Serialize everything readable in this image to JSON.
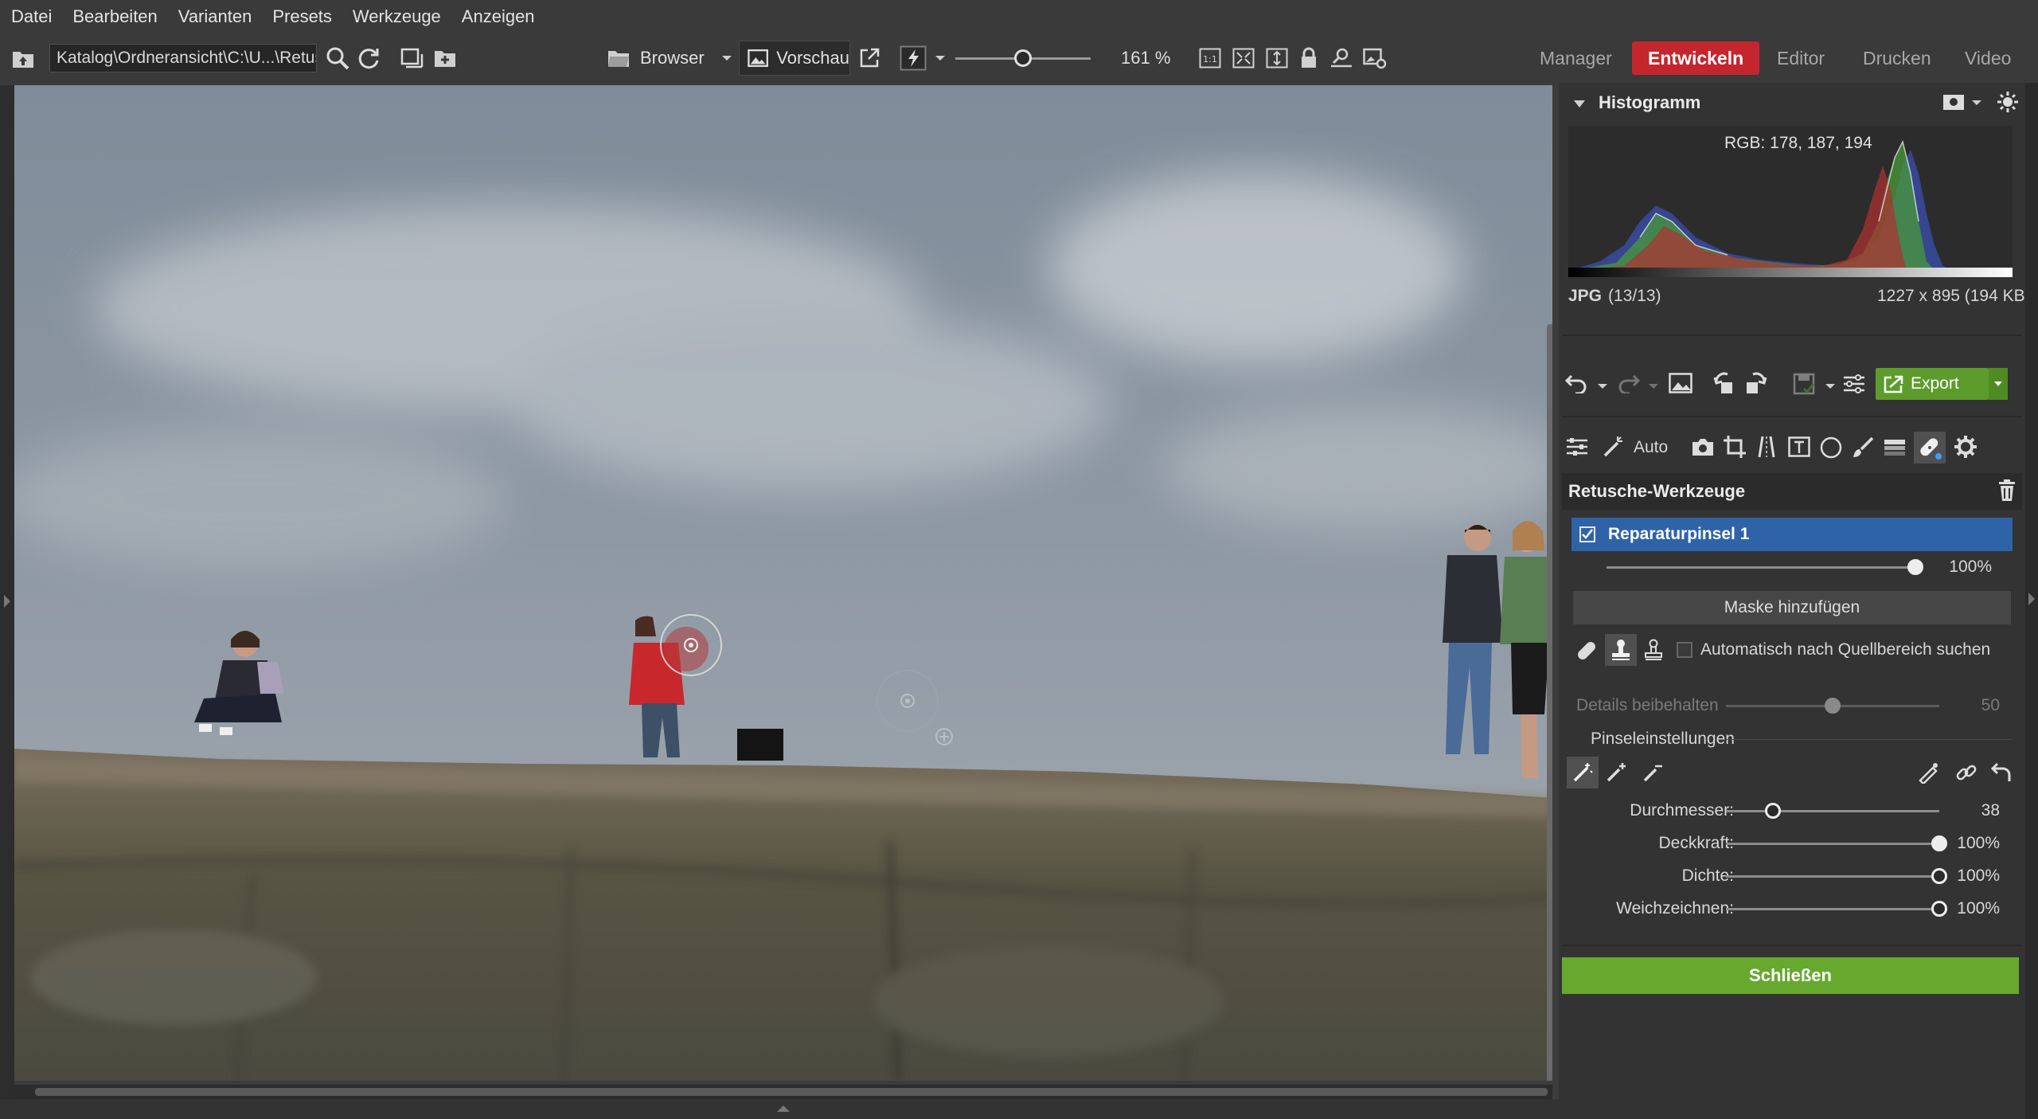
{
  "menu": [
    "Datei",
    "Bearbeiten",
    "Varianten",
    "Presets",
    "Werkzeuge",
    "Anzeigen"
  ],
  "toolbar": {
    "path": "Katalog\\Ordneransicht\\C:\\U...\\Retuš",
    "browser_label": "Browser",
    "preview_label": "Vorschau",
    "zoom": "161 %",
    "zoom_level": 0.5,
    "fit_label": "1:1"
  },
  "modules": [
    "Manager",
    "Entwickeln",
    "Editor",
    "Drucken",
    "Video"
  ],
  "active_module": "Entwickeln",
  "panel": {
    "histogram_title": "Histogramm",
    "rgb_readout": "RGB: 178, 187, 194",
    "file_type": "JPG",
    "file_index": "(13/13)",
    "file_info": "1227 x 895 (194 KB)",
    "export_label": "Export",
    "auto_label": "Auto",
    "section_title": "Retusche-Werkzeuge",
    "layer_name": "Reparaturpinsel 1",
    "layer_opacity": "100%",
    "layer_opacity_level": 1.0,
    "mask_button": "Maske hinzufügen",
    "auto_search_label": "Automatisch nach Quellbereich suchen",
    "details_label": "Details beibehalten",
    "details_value": "50",
    "details_level": 0.5,
    "brush_settings_title": "Pinseleinstellungen",
    "sliders": [
      {
        "label": "Durchmesser:",
        "value": "38",
        "level": 0.22
      },
      {
        "label": "Deckkraft:",
        "value": "100%",
        "level": 1.0
      },
      {
        "label": "Dichte:",
        "value": "100%",
        "level": 1.0
      },
      {
        "label": "Weichzeichnen:",
        "value": "100%",
        "level": 1.0
      }
    ],
    "close_button": "Schließen"
  },
  "colors": {
    "accent_red": "#c4262e",
    "selection_blue": "#2f63a8",
    "export_green": "#5d9c2c",
    "close_green": "#67a82e"
  }
}
